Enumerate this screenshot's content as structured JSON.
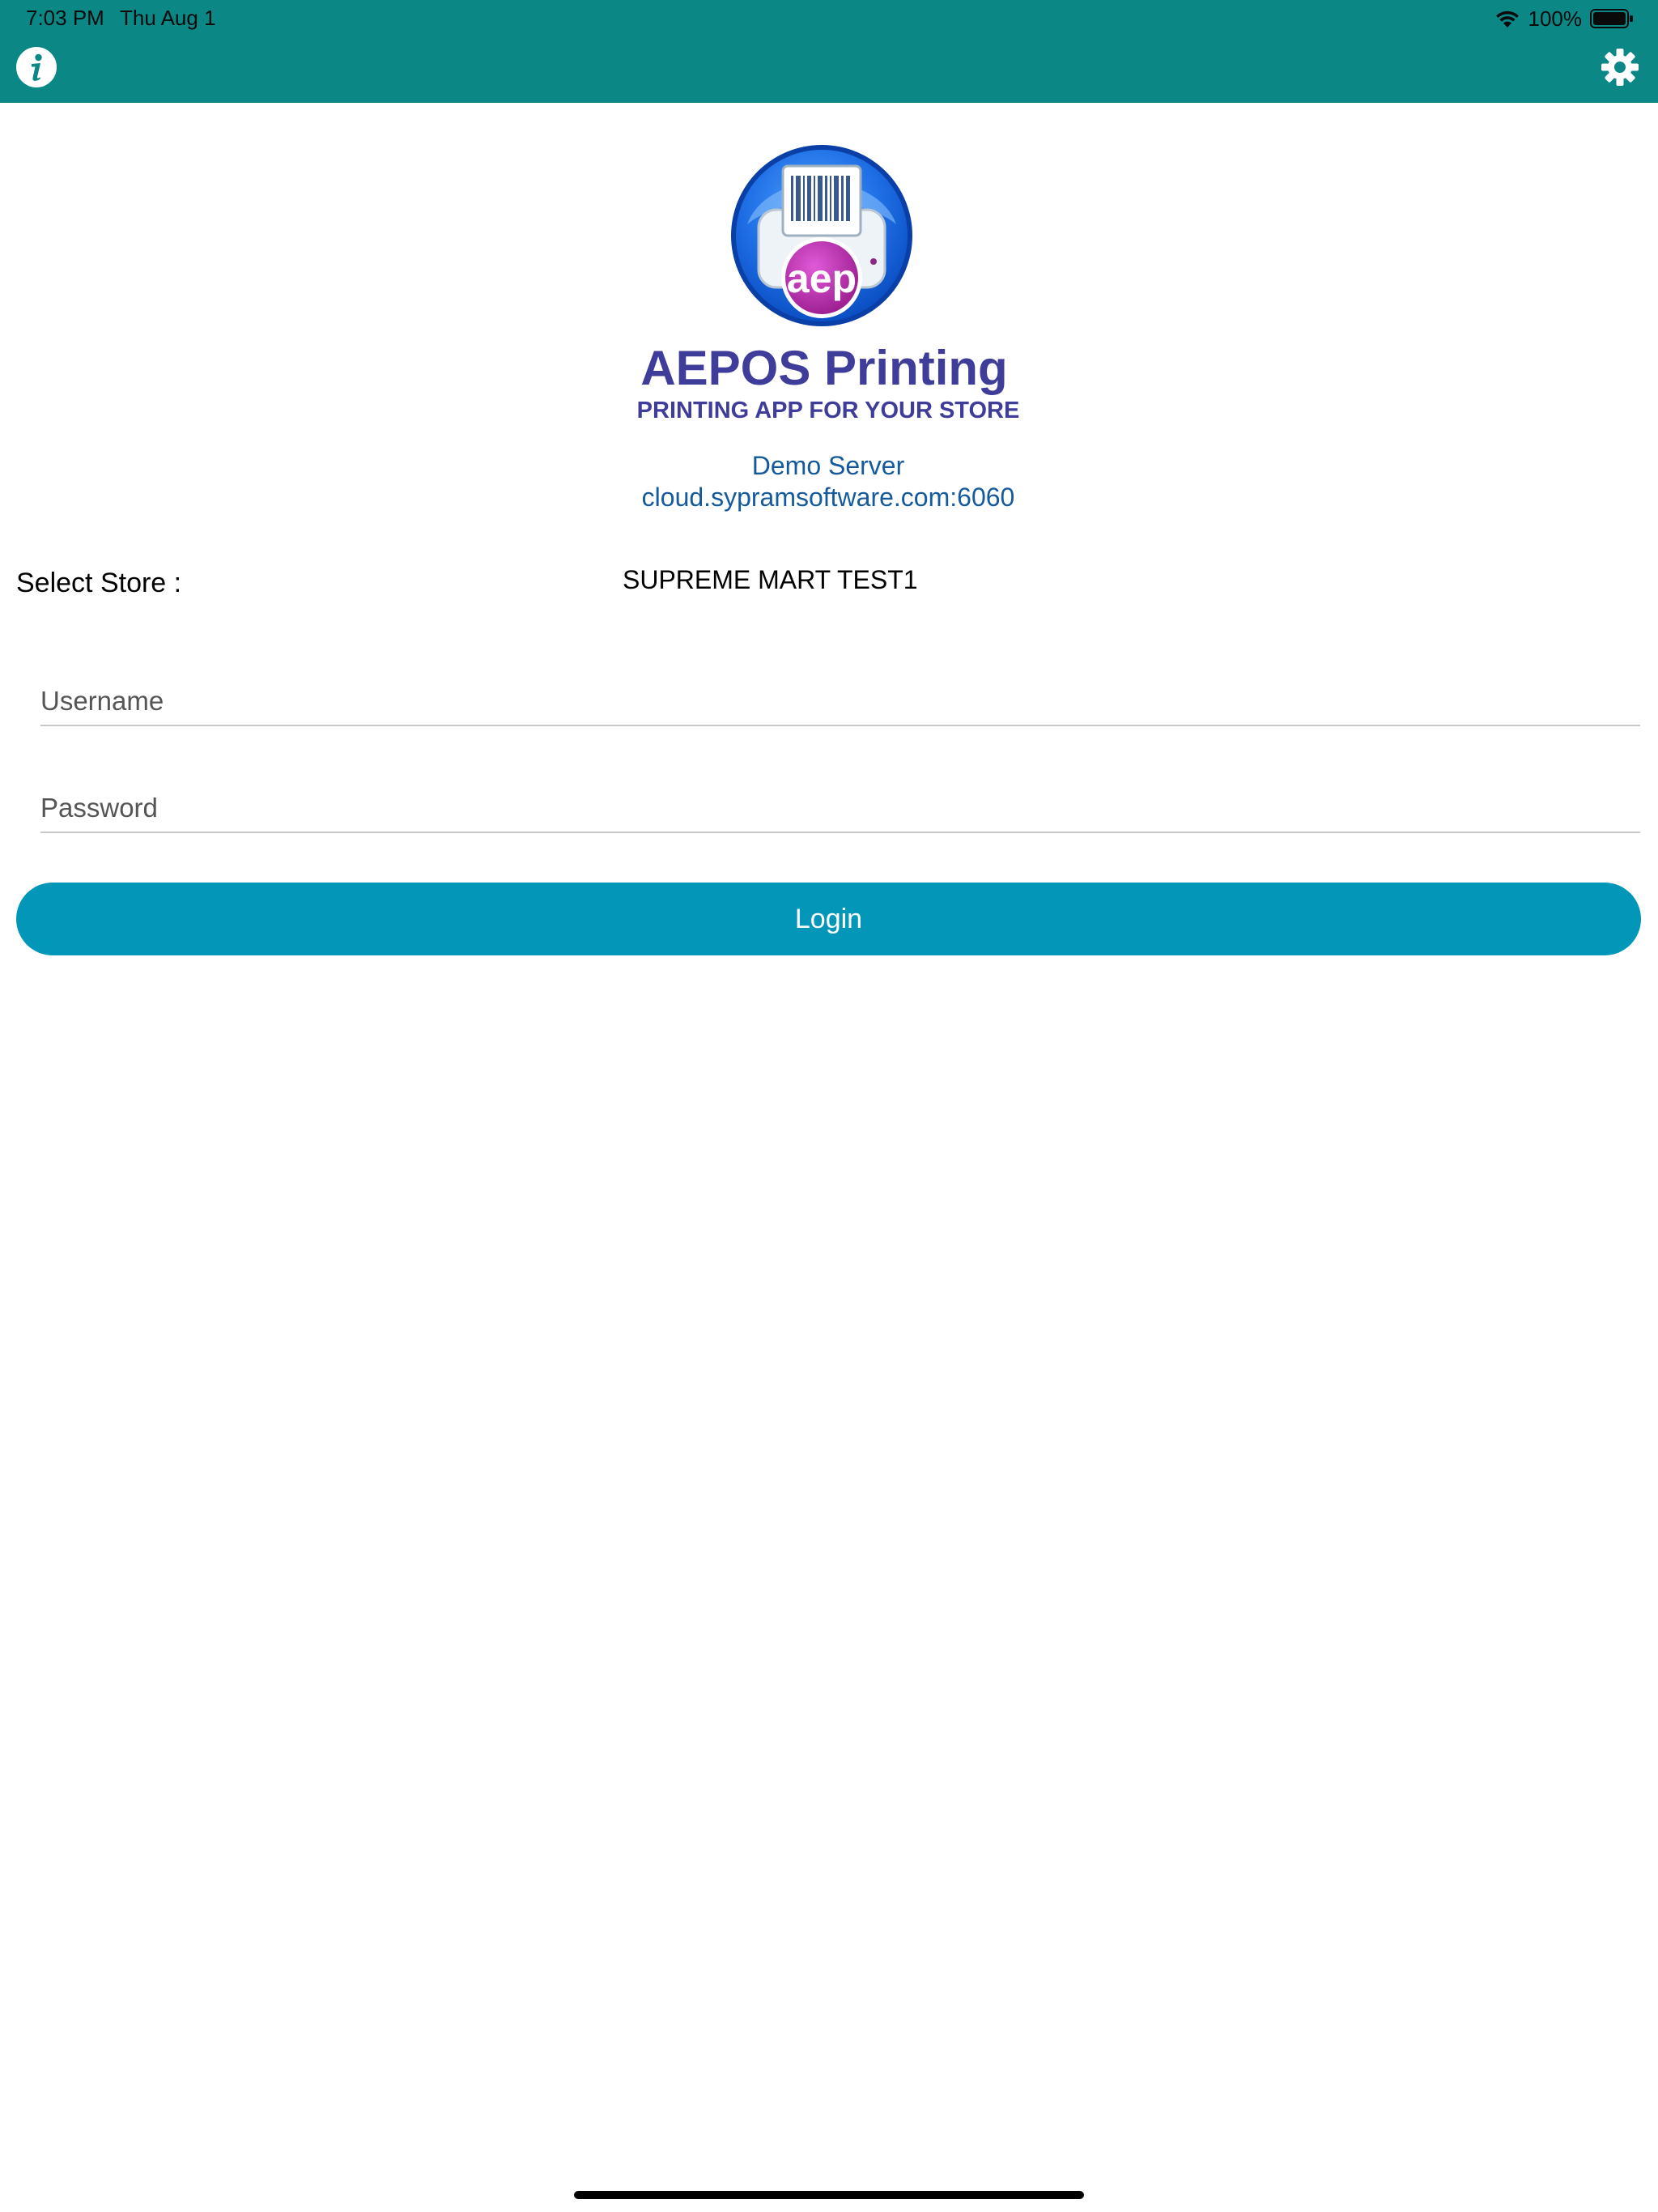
{
  "status_bar": {
    "time": "7:03 PM",
    "date": "Thu Aug 1",
    "battery": "100%"
  },
  "header": {
    "info_icon": "info-icon",
    "settings_icon": "gear-icon",
    "bar_color": "#0b8785"
  },
  "branding": {
    "logo_icon": "barcode-printer-logo",
    "logo_letters": "aep",
    "title": "AEPOS Printing",
    "subtitle": "PRINTING APP FOR YOUR STORE"
  },
  "server": {
    "name": "Demo Server",
    "url": "cloud.sypramsoftware.com:6060"
  },
  "store": {
    "label": "Select Store :",
    "value": "SUPREME MART TEST1"
  },
  "form": {
    "username_placeholder": "Username",
    "password_placeholder": "Password",
    "login_label": "Login",
    "login_color": "#0296b8"
  }
}
